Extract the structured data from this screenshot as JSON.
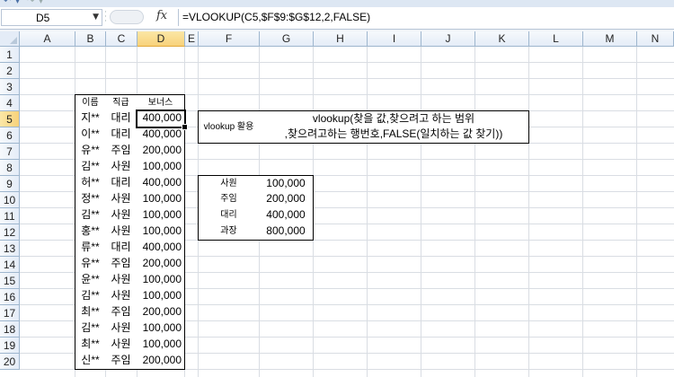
{
  "toolbar": {
    "glyphs": [
      "↶",
      "▾",
      "↷",
      "▾"
    ]
  },
  "formula_bar": {
    "name_box": "D5",
    "fx_label": "fx",
    "formula": "=VLOOKUP(C5,$F$9:$G$12,2,FALSE)"
  },
  "columns": [
    "A",
    "B",
    "C",
    "D",
    "E",
    "F",
    "G",
    "H",
    "I",
    "J",
    "K",
    "L",
    "M",
    "N"
  ],
  "selected_column": "D",
  "rows": [
    "1",
    "2",
    "3",
    "4",
    "5",
    "6",
    "7",
    "8",
    "9",
    "10",
    "11",
    "12",
    "13",
    "14",
    "15",
    "16",
    "17",
    "18",
    "19",
    "20"
  ],
  "selected_row": "5",
  "employees": {
    "headers": {
      "name": "이름",
      "rank": "직급",
      "bonus": "보너스"
    },
    "rows": [
      {
        "name": "지**",
        "rank": "대리",
        "bonus": "400,000"
      },
      {
        "name": "이**",
        "rank": "대리",
        "bonus": "400,000"
      },
      {
        "name": "유**",
        "rank": "주임",
        "bonus": "200,000"
      },
      {
        "name": "김**",
        "rank": "사원",
        "bonus": "100,000"
      },
      {
        "name": "허**",
        "rank": "대리",
        "bonus": "400,000"
      },
      {
        "name": "정**",
        "rank": "사원",
        "bonus": "100,000"
      },
      {
        "name": "김**",
        "rank": "사원",
        "bonus": "100,000"
      },
      {
        "name": "홍**",
        "rank": "사원",
        "bonus": "100,000"
      },
      {
        "name": "류**",
        "rank": "대리",
        "bonus": "400,000"
      },
      {
        "name": "유**",
        "rank": "주임",
        "bonus": "200,000"
      },
      {
        "name": "윤**",
        "rank": "사원",
        "bonus": "100,000"
      },
      {
        "name": "김**",
        "rank": "사원",
        "bonus": "100,000"
      },
      {
        "name": "최**",
        "rank": "주임",
        "bonus": "200,000"
      },
      {
        "name": "김**",
        "rank": "사원",
        "bonus": "100,000"
      },
      {
        "name": "최**",
        "rank": "사원",
        "bonus": "100,000"
      },
      {
        "name": "신**",
        "rank": "주임",
        "bonus": "200,000"
      }
    ]
  },
  "usage_note": {
    "label": "vlookup 활용",
    "line1": "vlookup(찾을 값,찾으려고 하는 범위",
    "line2": ",찾으려고하는 행번호,FALSE(일치하는 값 찾기))"
  },
  "lookup_table": [
    {
      "rank": "사원",
      "bonus": "100,000"
    },
    {
      "rank": "주임",
      "bonus": "200,000"
    },
    {
      "rank": "대리",
      "bonus": "400,000"
    },
    {
      "rank": "과장",
      "bonus": "800,000"
    }
  ]
}
